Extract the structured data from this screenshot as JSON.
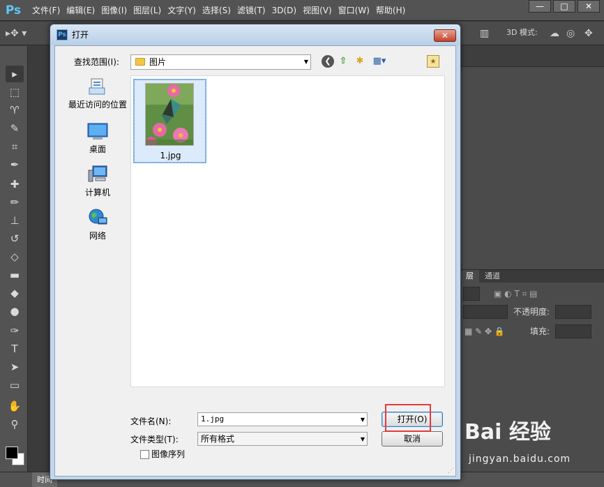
{
  "app": {
    "logo": "Ps",
    "menu": [
      "文件(F)",
      "编辑(E)",
      "图像(I)",
      "图层(L)",
      "文字(Y)",
      "选择(S)",
      "滤镜(T)",
      "3D(D)",
      "视图(V)",
      "窗口(W)",
      "帮助(H)"
    ],
    "window_controls": [
      "—",
      "□",
      "✕"
    ],
    "options_bar": {
      "mode3d_label": "3D 模式:"
    },
    "layers_panel": {
      "tabs": [
        "层",
        "通道"
      ],
      "opacity_label": "不透明度:",
      "fill_label": "填充:"
    },
    "bottom_tab": "时间"
  },
  "dialog": {
    "title": "打开",
    "close_label": "✕",
    "look_in_label": "查找范围(I):",
    "look_in_value": "图片",
    "places": [
      {
        "label": "最近访问的位置",
        "icon": "recent-places-icon"
      },
      {
        "label": "桌面",
        "icon": "desktop-icon"
      },
      {
        "label": "计算机",
        "icon": "computer-icon"
      },
      {
        "label": "网络",
        "icon": "network-icon"
      }
    ],
    "files": [
      {
        "name": "1.jpg"
      }
    ],
    "filename_label": "文件名(N):",
    "filename_value": "1.jpg",
    "filetype_label": "文件类型(T):",
    "filetype_value": "所有格式",
    "open_button": "打开(O)",
    "cancel_button": "取消",
    "sequence_checkbox_label": "图像序列"
  },
  "watermark": {
    "brand": "Bai 经验",
    "url": "jingyan.baidu.com"
  },
  "colors": {
    "ps_bg": "#535353",
    "dialog_frame": "#c3d6ea",
    "dialog_body": "#f0f0f0",
    "highlight_red": "#e23a3a",
    "ps_logo_blue": "#5ec6f8"
  }
}
